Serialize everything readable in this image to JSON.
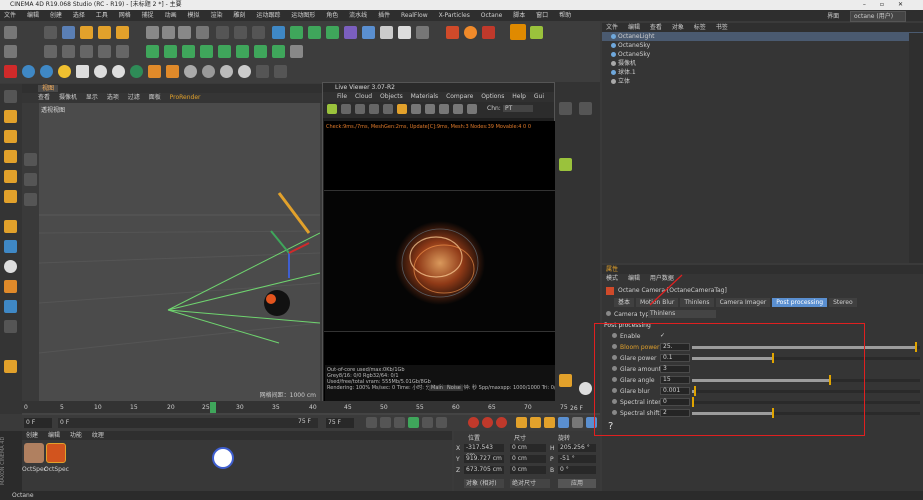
{
  "title": "CINEMA 4D R19.068 Studio (RC - R19) - [未标题 2 *] - 主要",
  "menu": [
    "文件",
    "编辑",
    "创建",
    "选择",
    "工具",
    "网格",
    "捕捉",
    "动画",
    "模拟",
    "渲染",
    "雕刻",
    "运动跟踪",
    "运动图形",
    "角色",
    "流水线",
    "插件",
    "RealFlow",
    "X-Particles",
    "Octane",
    "脚本",
    "窗口",
    "帮助"
  ],
  "layout": {
    "label": "界面",
    "value": "octane (用户)"
  },
  "viewport": {
    "tab": "视图",
    "menu": [
      "查看",
      "摄像机",
      "显示",
      "选项",
      "过滤",
      "面板",
      "ProRender"
    ],
    "camera_label": "透视视图",
    "grid_label": "网格间距：1000 cm"
  },
  "live_viewer": {
    "title": "Live Viewer 3.07-R2",
    "menu": [
      "File",
      "Cloud",
      "Objects",
      "Materials",
      "Compare",
      "Options",
      "Help",
      "Gui"
    ],
    "channel_label": "Chn:",
    "channel_value": "PT",
    "status": "Check:9ms./7ms, MeshGen:2ms, Update[C]:9ms, Mesh:3 Nodes:39 Movable:4 0 0",
    "stats": [
      "Out-of-core used/max:0Kb/1Gb",
      "Grey8/16: 0/0          Rgb32/64: 0/1",
      "Used/free/total vram: 555Mb/5.01Gb/8Gb",
      "Rendering: 100%   Ms/sec: 0   Time: 小时: 分钟: 秒/小时: 分钟: 秒   Spp/maxspp: 1000/1000   Tri: 0/2"
    ],
    "buttons": [
      "Main",
      "Noise"
    ]
  },
  "timeline": {
    "ticks": [
      "0",
      "5",
      "10",
      "15",
      "20",
      "25",
      "30",
      "35",
      "40",
      "45",
      "50",
      "55",
      "60",
      "65",
      "70",
      "75"
    ],
    "current_frame": "26",
    "end_label": "26 F"
  },
  "transport": {
    "start": "0 F",
    "current": "0 F",
    "end": "75 F",
    "end2": "75 F"
  },
  "materials": {
    "menu": [
      "创建",
      "编辑",
      "功能",
      "纹理"
    ],
    "items": [
      "OctSpec",
      "OctSpec"
    ]
  },
  "coords": {
    "headers": [
      "位置",
      "尺寸",
      "旋转"
    ],
    "rows": [
      {
        "axis": "X",
        "pos": "-317.543 cm",
        "size": "0 cm",
        "rotlabel": "H",
        "rot": "205.256 °"
      },
      {
        "axis": "Y",
        "pos": "919.727 cm",
        "size": "0 cm",
        "rotlabel": "P",
        "rot": "-51 °"
      },
      {
        "axis": "Z",
        "pos": "673.705 cm",
        "size": "0 cm",
        "rotlabel": "B",
        "rot": "0 °"
      }
    ],
    "mode1": "对象 (相对)",
    "mode2": "绝对尺寸",
    "apply": "应用"
  },
  "object_manager": {
    "menu": [
      "文件",
      "编辑",
      "查看",
      "对象",
      "标签",
      "书签"
    ],
    "objects": [
      "OctaneLight",
      "OctaneSky",
      "OctaneSky",
      "摄像机",
      "球体.1",
      "立体"
    ]
  },
  "attributes": {
    "menu": [
      "模式",
      "编辑",
      "用户数据"
    ],
    "tag_title": "Octane Camera [OctaneCameraTag]",
    "tabs": [
      "基本",
      "Motion Blur",
      "Thinlens",
      "Camera Imager",
      "Post processing",
      "Stereo"
    ],
    "active_tab": "Post processing",
    "camera_type_label": "Camera type",
    "camera_type_value": "Thinlens",
    "section": "Post processing",
    "params": [
      {
        "label": "Enable",
        "value": "✓",
        "fill": 0,
        "knob": 0,
        "has_slider": false
      },
      {
        "label": "Bloom power",
        "value": "25.",
        "fill": 0.98,
        "knob": 0.98,
        "has_slider": true
      },
      {
        "label": "Glare power",
        "value": "0.1",
        "fill": 0.35,
        "knob": 0.35,
        "has_slider": true
      },
      {
        "label": "Glare amount",
        "value": "3",
        "fill": 0,
        "knob": 0,
        "has_slider": true
      },
      {
        "label": "Glare angle",
        "value": "15",
        "fill": 0.6,
        "knob": 0.6,
        "has_slider": true
      },
      {
        "label": "Glare blur",
        "value": "0.001",
        "fill": 0.01,
        "knob": 0.01,
        "has_slider": true
      },
      {
        "label": "Spectral intensity",
        "value": "0",
        "fill": 0,
        "knob": 0,
        "has_slider": true
      },
      {
        "label": "Spectral shift",
        "value": "2",
        "fill": 0.35,
        "knob": 0.35,
        "has_slider": true
      }
    ],
    "bloom_color": "#e0a400"
  },
  "statusbar": "Octane",
  "brand": "MAXON CINEMA 4D"
}
